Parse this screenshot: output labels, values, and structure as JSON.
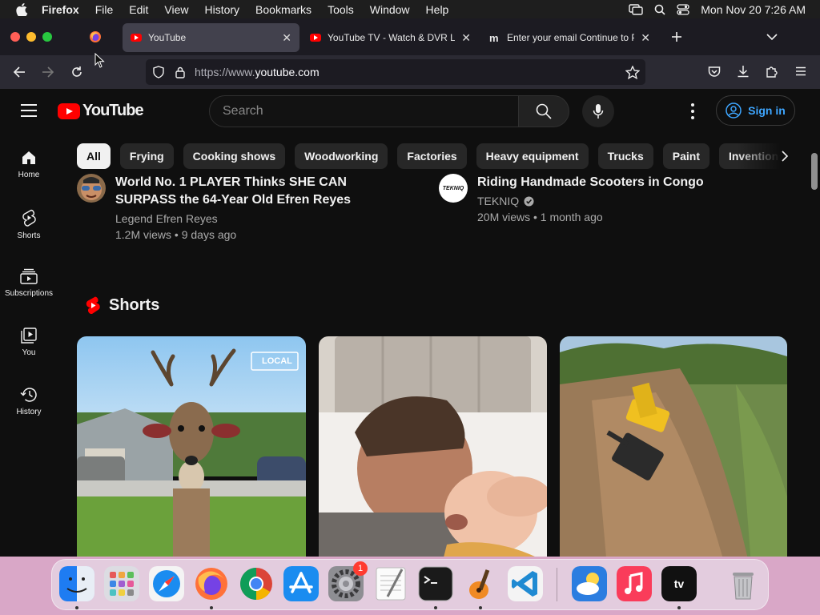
{
  "menubar": {
    "app": "Firefox",
    "items": [
      "File",
      "Edit",
      "View",
      "History",
      "Bookmarks",
      "Tools",
      "Window",
      "Help"
    ],
    "clock": "Mon Nov 20  7:26 AM"
  },
  "browser": {
    "tabs": [
      {
        "title": "YouTube",
        "favicon": "youtube-icon",
        "active": true
      },
      {
        "title": "YouTube TV - Watch & DVR Live",
        "favicon": "youtube-icon",
        "active": false
      },
      {
        "title": "Enter your email Continue to Po",
        "favicon": "m-icon",
        "favicon_text": "m",
        "active": false
      }
    ],
    "url_scheme": "https://www.",
    "url_host": "youtube.com"
  },
  "youtube": {
    "logo_text": "YouTube",
    "search_placeholder": "Search",
    "signin_label": "Sign in",
    "sidebar": [
      {
        "label": "Home",
        "icon": "home-icon"
      },
      {
        "label": "Shorts",
        "icon": "shorts-icon"
      },
      {
        "label": "Subscriptions",
        "icon": "subscriptions-icon"
      },
      {
        "label": "You",
        "icon": "you-icon"
      },
      {
        "label": "History",
        "icon": "history-icon"
      }
    ],
    "chips": [
      "All",
      "Frying",
      "Cooking shows",
      "Woodworking",
      "Factories",
      "Heavy equipment",
      "Trucks",
      "Paint",
      "Inventions"
    ],
    "videos": [
      {
        "title": "World No. 1 PLAYER Thinks SHE CAN SURPASS the 64-Year Old Efren Reyes",
        "channel": "Legend Efren Reyes",
        "stats": "1.2M views • 9 days ago"
      },
      {
        "title": "Riding Handmade Scooters in Congo",
        "channel": "TEKNIQ",
        "stats": "20M views • 1 month ago",
        "verified": true,
        "avatar_text": "TEKNIQ"
      }
    ],
    "shorts_title": "Shorts",
    "shorts": [
      {
        "name": "deer-short",
        "overlay_text": "LOCAL"
      },
      {
        "name": "father-baby-short"
      },
      {
        "name": "excavator-short"
      }
    ]
  },
  "dock": {
    "apps": [
      "Finder",
      "Launchpad",
      "Safari",
      "Firefox",
      "Chrome",
      "App Store",
      "System Settings",
      "TextEdit",
      "Terminal",
      "GarageBand",
      "VS Code",
      "Weather",
      "Music",
      "Apple TV",
      "Trash"
    ],
    "settings_badge": "1"
  },
  "colors": {
    "youtube_red": "#ff0000",
    "signin_blue": "#3ea6ff",
    "background": "#0f0f0f"
  }
}
